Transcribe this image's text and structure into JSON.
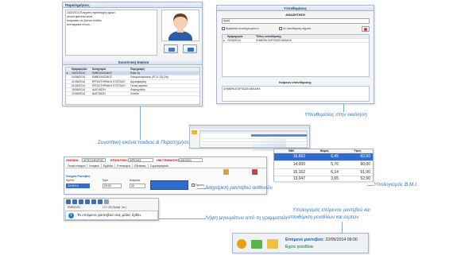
{
  "notes_window": {
    "title": "Παρατηρήσεις",
    "notes_lines": [
      "24/2/2014 Ελάχιστη πρόσληψη υγρών",
      "γενικά φαίνεται καλά",
      "σταματάει σε ξύπνιο στάδιο",
      "ανεπάρκεια ύπνου ..."
    ]
  },
  "visits_window": {
    "title": "Συνοπτική Εικόνα",
    "columns": [
      "Ημερομηνία",
      "Κατηγορία",
      "Περιγραφή"
    ],
    "rows": [
      [
        "16/07/2014",
        "ΕΜΒΟΛΙΑΣΜΟΣ",
        "Rota 1η"
      ],
      [
        "04/06/2014",
        "ΕΜΒΟΛΙΑΣΜΟΣ",
        "Πνευμονιόκοκκος (PCV-13) (3η)"
      ],
      [
        "21/05/2014",
        "ΕΡΓΑΣΤΗΡΙΑΚΗ ΕΞΕΤΑΣΗ",
        "Αιμοσφαιρίνη"
      ],
      [
        "21/05/2014",
        "ΕΡΓΑΣΤΗΡΙΑΚΗ ΕΞΕΤΑΣΗ",
        "Γενική αίματος"
      ],
      [
        "15/05/2014",
        "ΔΙΑΓΝΩΣΗ",
        "Φαρυγγίτιδα"
      ],
      [
        "12/05/2014",
        "ΔΙΑΓΝΩΣΗ",
        "Ωτίτιδα"
      ]
    ]
  },
  "reminders_window": {
    "title": "Υπενθυμίσεις",
    "header": "ΑΝΑΖΗΤΗΣΗ",
    "search_value": "Αρχή",
    "check_completed": "Εμφάνιση ολοκληρωμένων",
    "check_important": "Σε υπενθύμιση σημαία",
    "columns": [
      "Ημερομηνία",
      "Τίτλος υπενθύμισης"
    ],
    "row": [
      "22/05/2014",
      "ΣΗΜΕΡΑ ΕΟΡΤΑΖΕΙ ΜΙΧΑΗΛ"
    ],
    "text_section": "Κείμενο υπενθύμισης",
    "text_value": "ΣΗΜΕΡΑ ΕΟΡΤΑΖΕΙ ΜΙΧΑΗΛ"
  },
  "bmi_window": {
    "columns": [
      "BMI",
      "Βάρος",
      "Ύψος"
    ],
    "rows": [
      [
        "16,662",
        "6,45",
        "62,00"
      ],
      [
        "14,000",
        "5,76",
        "60,00"
      ],
      [
        "15,162",
        "6,14",
        "61,00"
      ],
      [
        "13,047",
        "3,65",
        "52,90"
      ]
    ],
    "selected_row": 0
  },
  "patient_form": {
    "surname_label": "ΕΠΩΝΥΜΟ:",
    "surname_value": "ΦΡΕΛΗΣ",
    "name_label": "ΟΝΟΜΑ:",
    "name_value": "ΧΡΙΣΤΟΦΟΡΟΣ",
    "birth_label": "ΗΜ.ΓΕΝΝΗΣΗΣ:",
    "birth_value": "4/5/2013",
    "tabs": [
      "Γενικά στοιχεία",
      "Ιστορικό",
      "Εμβόλια",
      "Επισκέψεις",
      "Εξετάσεις",
      "Σωματομετρικά"
    ],
    "section": "Στοιχεία Ραντεβού",
    "date_label": "Ημ/νία",
    "date_value": "22/05/14",
    "time_label": "Ώρα",
    "time_value": "09:00",
    "duration_label": "Διάρκεια",
    "duration_value": "30",
    "check_label": "Πρώτη"
  },
  "taskbar": {
    "user": "EMBODOC",
    "version": "Ι.3.7.28 (Πρόσβ. Ιατ.)",
    "notification": "Το επόμενο ραντεβού σας μόλις έρθει."
  },
  "next_appt": {
    "label": "Επόμενο ραντεβού:",
    "value": "22/05/2014 09:00",
    "subtitle": "Εχετε γενεθλια"
  },
  "callouts": {
    "reminders": "Υπενθυμίσεις στην εκκίνηση",
    "summary": "Συνοπτική εικόνα παιδιού & Παρατηρήσεις",
    "bmi": "Υπολογισμός B.M.I.",
    "appointments": "Διαχείριση ραντεβού ασθενών",
    "messages": "Λήψη μηνυμάτων από τη γραμματεία",
    "next_line1": "Υπολογισμός επόμενου ραντεβού και",
    "next_line2": "υπενθύμιση γενεθλίων και εορτών"
  },
  "colors": {
    "callout": "#2f78c9",
    "header_blue": "#2458a8",
    "grid_header": "#e9edf2",
    "selection": "#c8d9f1"
  }
}
